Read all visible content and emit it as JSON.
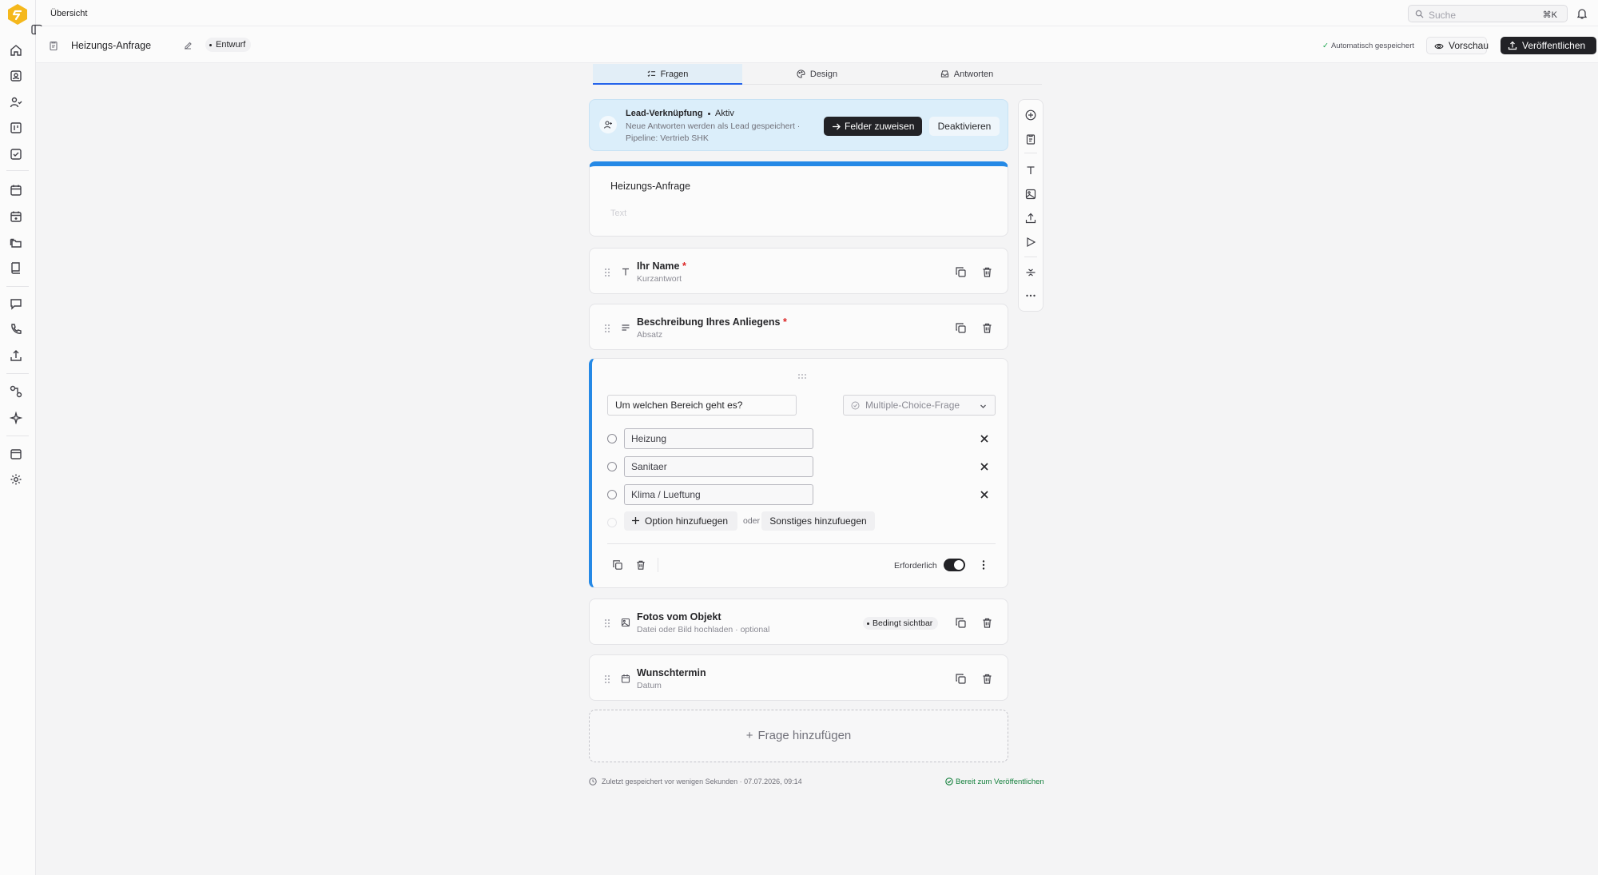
{
  "app": {
    "breadcrumb": "Übersicht",
    "accent_color": "#2589e6",
    "logo_color": "#f5b81c"
  },
  "rail": {
    "icons": [
      "home-icon",
      "contacts-icon",
      "users-icon",
      "board-icon",
      "tasks-icon",
      "calendar-icon",
      "calendar-plus-icon",
      "folders-icon",
      "book-icon",
      "chat-icon",
      "phone-icon",
      "upload-icon",
      "workflow-icon",
      "sparkles-icon",
      "calendar-small-icon",
      "settings-icon"
    ]
  },
  "search": {
    "placeholder": "Suche",
    "shortcut": "⌘K"
  },
  "header": {
    "form_title": "Heizungs-Anfrage",
    "status_badge": "Entwurf",
    "autosave": "Automatisch gespeichert",
    "preview_label": "Vorschau",
    "publish_label": "Veröffentlichen"
  },
  "tabs": [
    {
      "label": "Fragen",
      "icon": "list-check-icon",
      "active": true
    },
    {
      "label": "Design",
      "icon": "palette-icon",
      "active": false
    },
    {
      "label": "Antworten",
      "icon": "inbox-icon",
      "active": false
    }
  ],
  "lead": {
    "title": "Lead-Verknüpfung",
    "status": "Aktiv",
    "desc1": "Neue Antworten werden als Lead gespeichert ·",
    "desc2": "Pipeline: Vertrieb SHK",
    "assign_label": "Felder zuweisen",
    "deactivate_label": "Deaktivieren"
  },
  "form_card": {
    "title": "Heizungs-Anfrage",
    "description_placeholder": "Text"
  },
  "questions": [
    {
      "title": "Ihr Name",
      "required_mark": "*",
      "subtitle": "Kurzantwort",
      "icon": "text-type-icon"
    },
    {
      "title": "Beschreibung Ihres Anliegens",
      "required_mark": "*",
      "subtitle": "Absatz",
      "icon": "paragraph-icon"
    },
    {
      "title": "Fotos vom Objekt",
      "subtitle": "Datei oder Bild hochladen · optional",
      "badge": "Bedingt sichtbar",
      "icon": "image-icon"
    },
    {
      "title": "Wunschtermin",
      "subtitle": "Datum",
      "icon": "calendar-icon"
    }
  ],
  "editor": {
    "question": "Um welchen Bereich geht es?",
    "type": "Multiple-Choice-Frage",
    "options": [
      "Heizung",
      "Sanitaer",
      "Klima / Lueftung"
    ],
    "add_option_label": "Option hinzufuegen",
    "or_label": "oder",
    "add_other_label": "Sonstiges hinzufuegen",
    "required_label": "Erforderlich",
    "required": true
  },
  "add_question_label": "Frage hinzufügen",
  "footer": {
    "saved": "Zuletzt gespeichert vor wenigen Sekunden · 07.07.2026, 09:14",
    "ready": "Bereit zum Veröffentlichen"
  }
}
